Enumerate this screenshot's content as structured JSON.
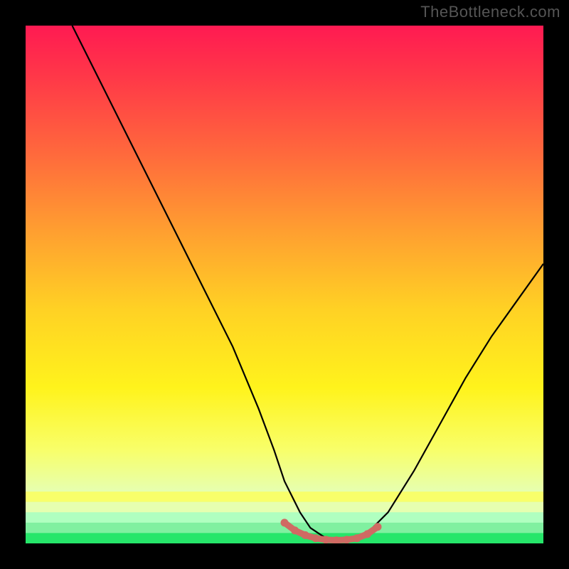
{
  "watermark": "TheBottleneck.com",
  "chart_data": {
    "type": "line",
    "title": "",
    "xlabel": "",
    "ylabel": "",
    "xlim": [
      0,
      100
    ],
    "ylim": [
      0,
      100
    ],
    "curve": {
      "name": "bottleneck-curve",
      "x": [
        9,
        15,
        20,
        25,
        30,
        35,
        40,
        45,
        48,
        50,
        53,
        55,
        58,
        60,
        63,
        65,
        70,
        75,
        80,
        85,
        90,
        95,
        100
      ],
      "y": [
        100,
        88,
        78,
        68,
        58,
        48,
        38,
        26,
        18,
        12,
        6,
        3,
        1,
        0.5,
        0.5,
        1,
        6,
        14,
        23,
        32,
        40,
        47,
        54
      ]
    },
    "highlight": {
      "name": "optimal-range",
      "color": "#d06a63",
      "x": [
        50,
        52,
        54,
        56,
        58,
        60,
        62,
        64,
        66,
        68
      ],
      "y": [
        4,
        2.5,
        1.6,
        1.0,
        0.7,
        0.6,
        0.7,
        1.0,
        1.8,
        3.2
      ]
    },
    "background_gradient": {
      "stops": [
        {
          "offset": 0,
          "color": "#ff1a52"
        },
        {
          "offset": 10,
          "color": "#ff3848"
        },
        {
          "offset": 25,
          "color": "#ff6a3c"
        },
        {
          "offset": 40,
          "color": "#ffa030"
        },
        {
          "offset": 55,
          "color": "#ffd224"
        },
        {
          "offset": 70,
          "color": "#fff31c"
        },
        {
          "offset": 82,
          "color": "#f8ff6a"
        },
        {
          "offset": 90,
          "color": "#e6ffb0"
        },
        {
          "offset": 95,
          "color": "#b0ffc0"
        },
        {
          "offset": 100,
          "color": "#26e66a"
        }
      ]
    },
    "bottom_bands": [
      {
        "from": 90,
        "to": 92,
        "color": "#f8ff6a"
      },
      {
        "from": 92,
        "to": 94,
        "color": "#e6ffb0"
      },
      {
        "from": 94,
        "to": 96,
        "color": "#b0ffc0"
      },
      {
        "from": 96,
        "to": 98,
        "color": "#80f0a0"
      },
      {
        "from": 98,
        "to": 100,
        "color": "#26e66a"
      }
    ]
  }
}
